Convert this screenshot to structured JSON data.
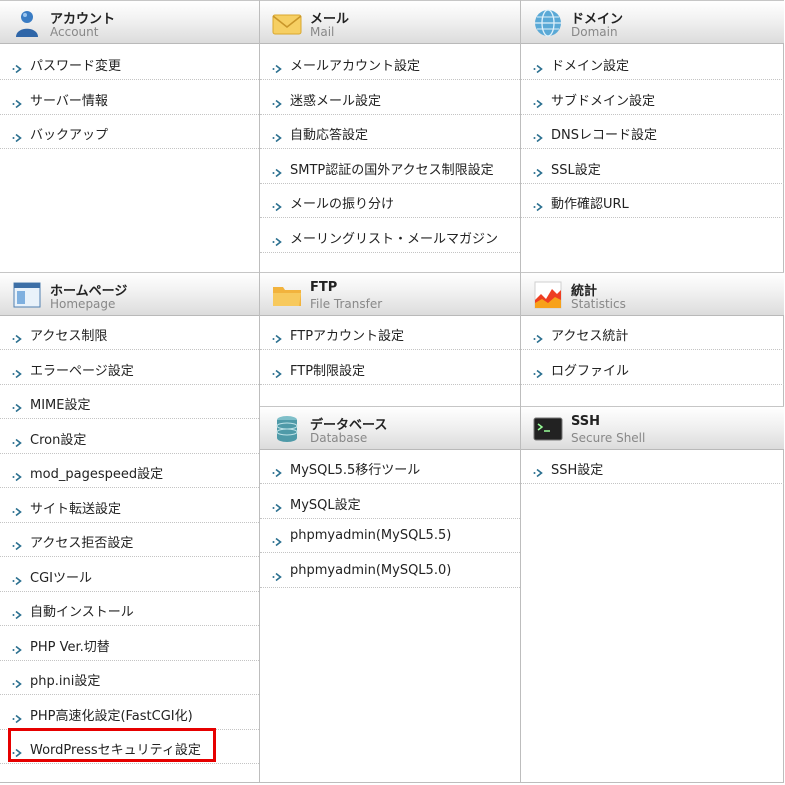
{
  "account": {
    "title": "アカウント",
    "subtitle": "Account",
    "icon": "account-user-icon",
    "items": [
      "パスワード変更",
      "サーバー情報",
      "バックアップ"
    ]
  },
  "mail": {
    "title": "メール",
    "subtitle": "Mail",
    "icon": "envelope-icon",
    "items": [
      "メールアカウント設定",
      "迷惑メール設定",
      "自動応答設定",
      "SMTP認証の国外アクセス制限設定",
      "メールの振り分け",
      "メーリングリスト・メールマガジン"
    ]
  },
  "domain": {
    "title": "ドメイン",
    "subtitle": "Domain",
    "icon": "globe-icon",
    "items": [
      "ドメイン設定",
      "サブドメイン設定",
      "DNSレコード設定",
      "SSL設定",
      "動作確認URL"
    ]
  },
  "homepage": {
    "title": "ホームページ",
    "subtitle": "Homepage",
    "icon": "browser-window-icon",
    "items": [
      "アクセス制限",
      "エラーページ設定",
      "MIME設定",
      "Cron設定",
      "mod_pagespeed設定",
      "サイト転送設定",
      "アクセス拒否設定",
      "CGIツール",
      "自動インストール",
      "PHP Ver.切替",
      "php.ini設定",
      "PHP高速化設定(FastCGI化)",
      "WordPressセキュリティ設定"
    ]
  },
  "ftp": {
    "title": "FTP",
    "subtitle": "File Transfer",
    "icon": "folder-icon",
    "items": [
      "FTPアカウント設定",
      "FTP制限設定"
    ]
  },
  "stats": {
    "title": "統計",
    "subtitle": "Statistics",
    "icon": "chart-icon",
    "items": [
      "アクセス統計",
      "ログファイル"
    ]
  },
  "database": {
    "title": "データベース",
    "subtitle": "Database",
    "icon": "database-icon",
    "items": [
      "MySQL5.5移行ツール",
      "MySQL設定",
      "phpmyadmin(MySQL5.5)",
      "phpmyadmin(MySQL5.0)"
    ]
  },
  "ssh": {
    "title": "SSH",
    "subtitle": "Secure Shell",
    "icon": "terminal-icon",
    "items": [
      "SSH設定"
    ]
  },
  "colors": {
    "highlight": "#e60000",
    "arrow": "#2a6f8f"
  }
}
